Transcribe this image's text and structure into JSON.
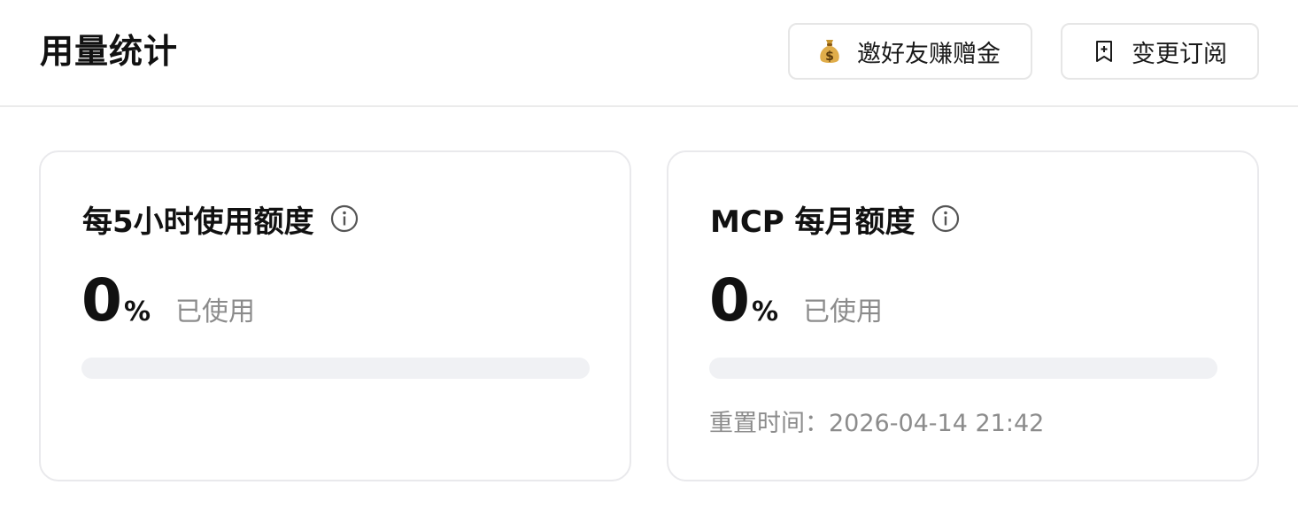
{
  "header": {
    "title": "用量统计",
    "invite_button": {
      "icon": "moneybag-icon",
      "label": "邀好友赚赠金"
    },
    "subscription_button": {
      "icon": "bookmark-plus-icon",
      "label": "变更订阅"
    }
  },
  "cards": [
    {
      "title": "每5小时使用额度",
      "info_icon": "info-icon",
      "usage_value": "0",
      "usage_unit": "%",
      "usage_label": "已使用",
      "progress_percent": 0
    },
    {
      "title": "MCP 每月额度",
      "info_icon": "info-icon",
      "usage_value": "0",
      "usage_unit": "%",
      "usage_label": "已使用",
      "progress_percent": 0,
      "reset_time": "重置时间：2026-04-14 21:42"
    }
  ],
  "colors": {
    "progress_track": "#f0f1f4",
    "muted_text": "#8c8c8c",
    "border": "#e9e9ec"
  }
}
